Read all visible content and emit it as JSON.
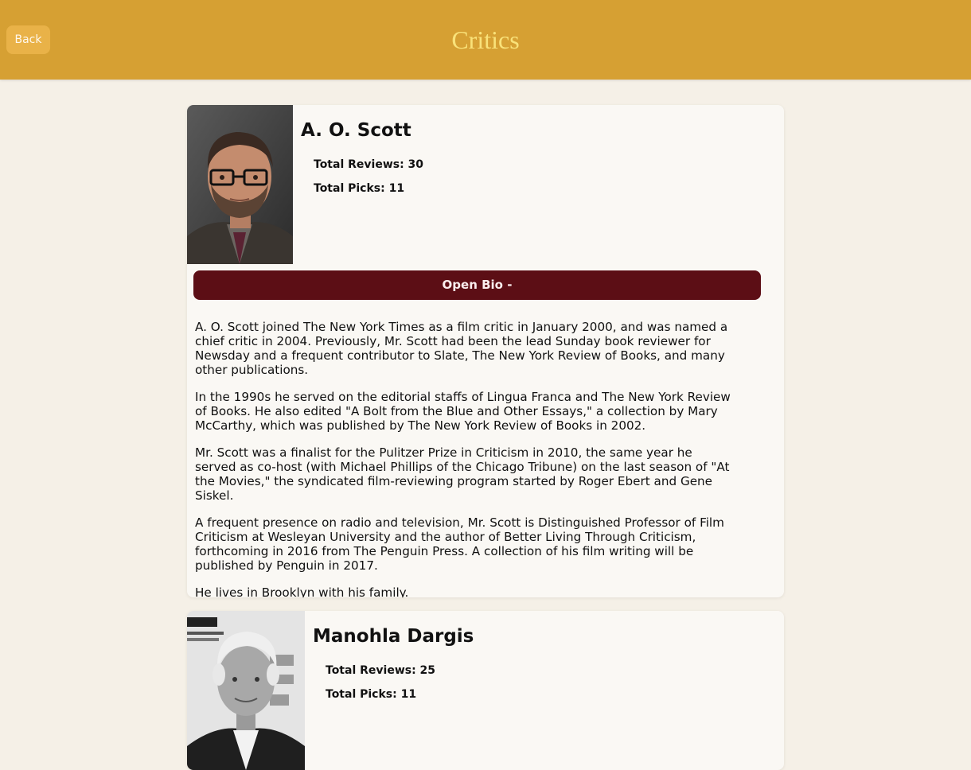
{
  "header": {
    "title": "Critics",
    "back_label": "Back"
  },
  "colors": {
    "header_bg": "#d6a033",
    "title": "#f9e27a",
    "button_bg": "#5c0e15",
    "page_bg": "#f5f0e7"
  },
  "critics": [
    {
      "name": "A. O. Scott",
      "total_reviews": "Total Reviews: 30",
      "total_picks": "Total Picks: 11",
      "bio_button_label": "Open Bio -",
      "bio": [
        "A. O. Scott joined The New York Times as a film critic in January 2000, and was named a chief critic in 2004. Previously, Mr. Scott had been the lead Sunday book reviewer for Newsday and a frequent contributor to Slate, The New York Review of Books, and many other publications.",
        "In the 1990s he served on the editorial staffs of Lingua Franca and The New York Review of Books. He also edited \"A Bolt from the Blue and Other Essays,\" a collection by Mary McCarthy, which was published by The New York Review of Books in 2002.",
        "Mr. Scott was a finalist for the Pulitzer Prize in Criticism in 2010, the same year he served as co-host (with Michael Phillips of the Chicago Tribune) on the last season of \"At the Movies,\" the syndicated film-reviewing program started by Roger Ebert and Gene Siskel.",
        "A frequent presence on radio and television, Mr. Scott is Distinguished Professor of Film Criticism at Wesleyan University and the author of Better Living Through Criticism, forthcoming in 2016 from The Penguin Press. A collection of his film writing will be published by Penguin in 2017.",
        "He lives in Brooklyn with his family."
      ]
    },
    {
      "name": "Manohla Dargis",
      "total_reviews": "Total Reviews: 25",
      "total_picks": "Total Picks: 11"
    }
  ]
}
